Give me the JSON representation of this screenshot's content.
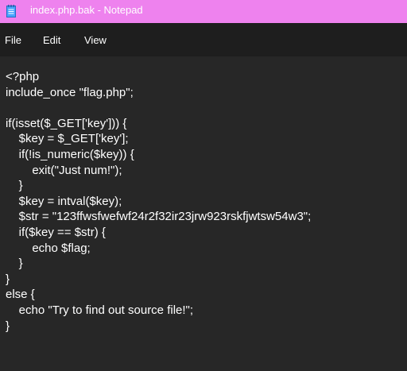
{
  "window": {
    "title": "index.php.bak - Notepad",
    "icon": "notepad-icon"
  },
  "menu": {
    "file": "File",
    "edit": "Edit",
    "view": "View"
  },
  "editor": {
    "lines": [
      "<?php",
      "include_once \"flag.php\";",
      "",
      "if(isset($_GET['key'])) {",
      "    $key = $_GET['key'];",
      "    if(!is_numeric($key)) {",
      "        exit(\"Just num!\");",
      "    }",
      "    $key = intval($key);",
      "    $str = \"123ffwsfwefwf24r2f32ir23jrw923rskfjwtsw54w3\";",
      "    if($key == $str) {",
      "        echo $flag;",
      "    }",
      "}",
      "else {",
      "    echo \"Try to find out source file!\";",
      "}"
    ]
  },
  "colors": {
    "titlebar": "#ee82ee",
    "menubar": "#1e1e1e",
    "editor_bg": "#272727",
    "text": "#ffffff"
  }
}
